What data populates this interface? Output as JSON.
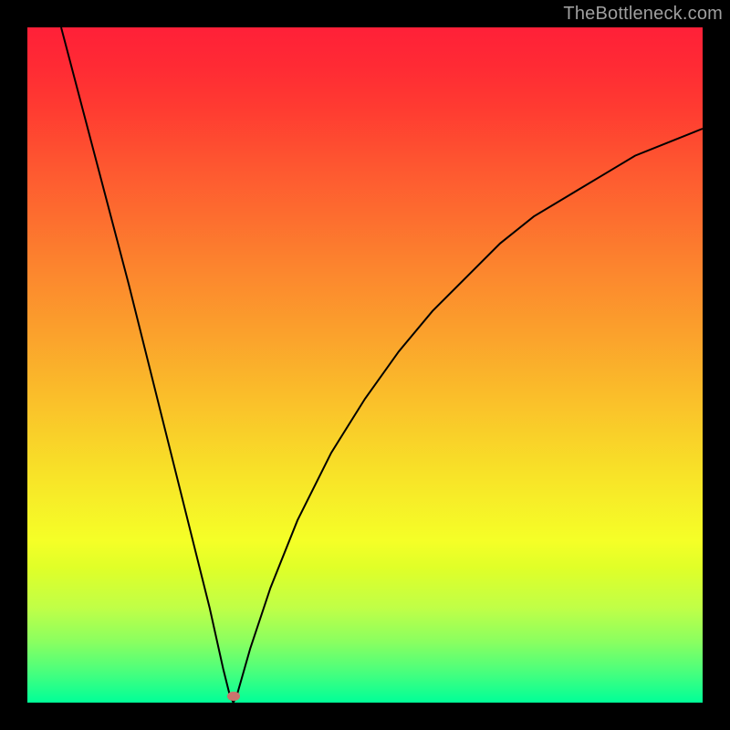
{
  "watermark": {
    "text": "TheBottleneck.com"
  },
  "chart_data": {
    "type": "line",
    "title": "",
    "xlabel": "",
    "ylabel": "",
    "xlim": [
      0,
      100
    ],
    "ylim": [
      0,
      100
    ],
    "grid": false,
    "legend": false,
    "marker": {
      "x": 30.5,
      "y": 1.0,
      "color": "#c9746d"
    },
    "series": [
      {
        "name": "curve",
        "x": [
          5,
          10,
          15,
          20,
          25,
          27,
          29,
          30,
          30.5,
          31,
          33,
          36,
          40,
          45,
          50,
          55,
          60,
          65,
          70,
          75,
          80,
          85,
          90,
          95,
          100
        ],
        "values": [
          100,
          81,
          62,
          42,
          22,
          14,
          5,
          1,
          0,
          1,
          8,
          17,
          27,
          37,
          45,
          52,
          58,
          63,
          68,
          72,
          75,
          78,
          81,
          83,
          85
        ]
      }
    ]
  }
}
